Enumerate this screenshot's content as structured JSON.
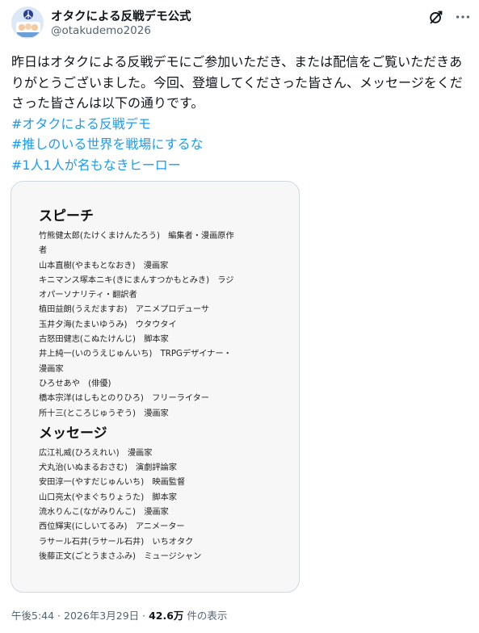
{
  "account": {
    "name": "オタクによる反戦デモ公式",
    "handle": "@otakudemo2026",
    "avatar_icon": "avatar-icon"
  },
  "toolbar": {
    "grok_icon": "grok-icon",
    "more_icon": "more-icon"
  },
  "tweet": {
    "body": "昨日はオタクによる反戦デモにご参加いただき、または配信をご覧いただきありがとうございました。今回、登壇してくださった皆さん、メッセージをくださった皆さんは以下の通りです。",
    "hashtags": [
      "#オタクによる反戦デモ",
      "#推しのいる世界を戦場にするな",
      "#1人1人が名もなきヒーロー"
    ]
  },
  "image": {
    "speech_title": "スピーチ",
    "speech_lines": [
      "竹熊健太郎(たけくまけんたろう)　編集者・漫画原作",
      "者",
      "山本直樹(やまもとなおき)　漫画家",
      "キニマンス塚本ニキ(きにまんすつかもとみき)　ラジ",
      "オパーソナリティ・翻訳者",
      "植田益朗(うえだますお)　アニメプロデューサ",
      "玉井夕海(たまいゆうみ)　ウタウタイ",
      "古怒田健志(こぬたけんじ)　脚本家",
      "井上純一(いのうえじゅんいち)　TRPGデザイナー・",
      "漫画家",
      "ひろせあや　(俳優)",
      "橋本宗洋(はしもとのりひろ)　フリーライター",
      "所十三(ところじゅうぞう)　漫画家"
    ],
    "message_title": "メッセージ",
    "message_lines": [
      "広江礼威(ひろえれい)　漫画家",
      "犬丸治(いぬまるおさむ)　演劇評論家",
      "安田淳一(やすだじゅんいち)　映画監督",
      "山口亮太(やまぐちりょうた)　脚本家",
      "流水りんこ(ながみりんこ)　漫画家",
      "西位輝実(にしいてるみ)　アニメーター",
      "ラサール石井(ラサール石井)　いちオタク",
      "後藤正文(ごとうまさふみ)　ミュージシャン"
    ]
  },
  "meta": {
    "time": "午後5:44",
    "separator": " · ",
    "date": "2026年3月29日",
    "separator2": " · ",
    "views": "42.6万",
    "views_label": " 件の表示"
  }
}
